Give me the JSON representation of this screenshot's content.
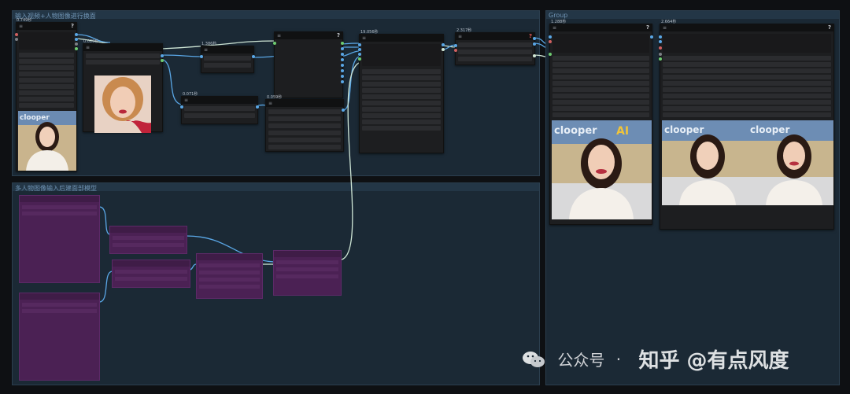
{
  "groups": {
    "g1_title": "输入视频+人物图像进行换面",
    "g2_title": "多人物图像输入后建面部模型",
    "g3_title": "Group"
  },
  "timings": {
    "n1": "0.749秒",
    "n2": "0.029秒",
    "n3": "1.386秒",
    "n4": "0.071秒",
    "n5": "0.059秒",
    "n6": "19.056秒",
    "n7": "2.317秒",
    "n8": "1.288秒",
    "n9": "2.664秒"
  },
  "node_icons": {
    "menu_glyph": "≡",
    "help_glyph": "?"
  },
  "image_text": {
    "clooper": "clooper",
    "clooper_suffix": "AI"
  },
  "watermark": {
    "platform": "公众号",
    "dot": "·",
    "author": "知乎 @有点风度"
  },
  "colors": {
    "link_blue": "#5aa7e6",
    "link_pale": "#cfe6d6",
    "group_bg": "#1b2935",
    "purple_node": "#4b2154"
  }
}
